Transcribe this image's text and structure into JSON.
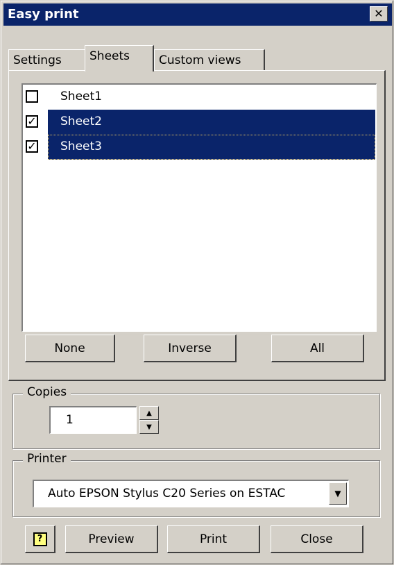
{
  "window": {
    "title": "Easy print",
    "close_glyph": "✕"
  },
  "tabs": [
    {
      "label": "Settings",
      "active": false
    },
    {
      "label": "Sheets",
      "active": true
    },
    {
      "label": "Custom views",
      "active": false
    }
  ],
  "sheets": [
    {
      "label": "Sheet1",
      "checked": false,
      "selected": false
    },
    {
      "label": "Sheet2",
      "checked": true,
      "selected": true
    },
    {
      "label": "Sheet3",
      "checked": true,
      "selected": true
    }
  ],
  "sheet_buttons": {
    "none": "None",
    "inverse": "Inverse",
    "all": "All"
  },
  "copies": {
    "legend": "Copies",
    "value": "1",
    "up_glyph": "▲",
    "down_glyph": "▼"
  },
  "printer": {
    "legend": "Printer",
    "value": "Auto EPSON Stylus C20 Series on ESTAC",
    "arrow_glyph": "▼"
  },
  "footer": {
    "help_icon": "help-icon",
    "help_glyph": "?",
    "preview": "Preview",
    "print": "Print",
    "close": "Close"
  },
  "colors": {
    "titlebar": "#0a246a",
    "face": "#d4d0c8",
    "selection": "#0a246a"
  }
}
